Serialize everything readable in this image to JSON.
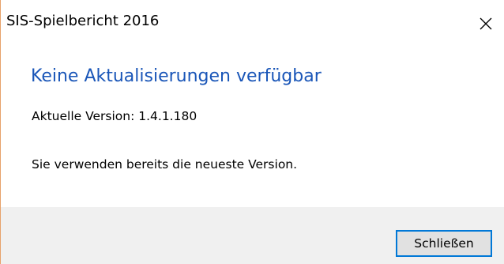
{
  "window": {
    "title": "SIS-Spielbericht 2016"
  },
  "content": {
    "heading": "Keine Aktualisierungen verfügbar",
    "version_text": "Aktuelle Version: 1.4.1.180",
    "message": "Sie verwenden bereits die neueste Version."
  },
  "footer": {
    "close_button_label": "Schließen"
  },
  "icons": {
    "close": "close-icon"
  },
  "colors": {
    "heading": "#1a56b8",
    "button_focus_border": "#0078d7",
    "footer_background": "#f0f0f0",
    "window_border": "#e7a26a"
  }
}
